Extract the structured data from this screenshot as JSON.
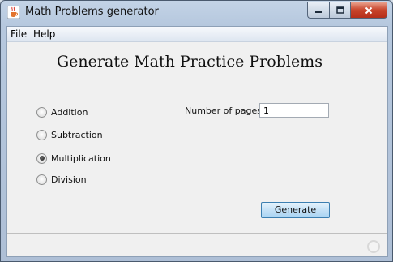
{
  "window": {
    "title": "Math Problems generator",
    "app_icon": "java-cup-icon"
  },
  "menu": [
    {
      "label": "File"
    },
    {
      "label": "Help"
    }
  ],
  "heading": "Generate Math Practice Problems",
  "operations": [
    {
      "label": "Addition",
      "selected": false
    },
    {
      "label": "Subtraction",
      "selected": false
    },
    {
      "label": "Multiplication",
      "selected": true
    },
    {
      "label": "Division",
      "selected": false
    }
  ],
  "pages": {
    "label": "Number of pages",
    "value": "1"
  },
  "generate_label": "Generate",
  "colors": {
    "accent": "#3c7fb1",
    "close_button": "#c7432a"
  }
}
